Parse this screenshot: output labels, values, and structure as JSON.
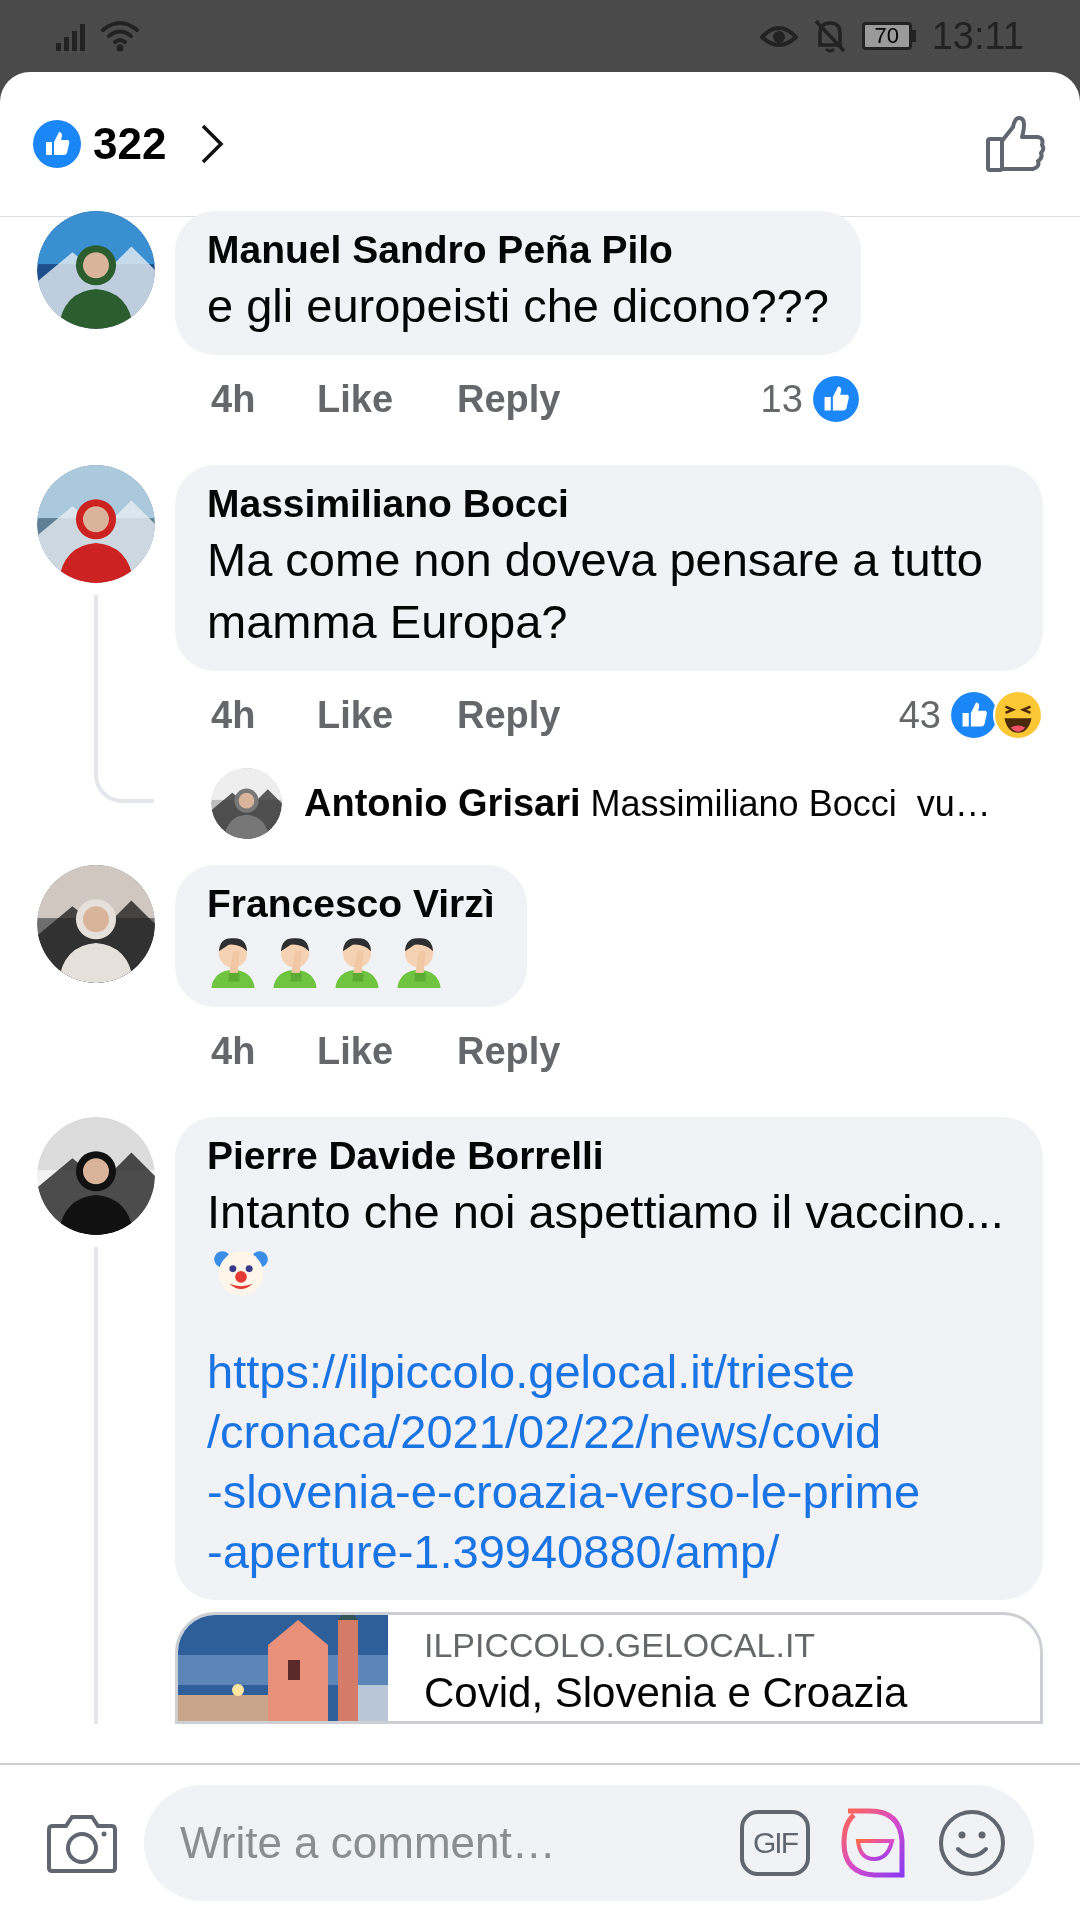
{
  "status_bar": {
    "battery": "70",
    "time": "13:11"
  },
  "header": {
    "reaction_count": "322"
  },
  "comments": [
    {
      "author": "Manuel Sandro Peña Pilo",
      "lines": [
        "e gli europeisti che dicono???"
      ],
      "time": "4h",
      "like": "Like",
      "reply": "Reply",
      "reaction_count": "13",
      "reactions": [
        {
          "kind": "like"
        }
      ],
      "thread": false
    },
    {
      "author": "Massimiliano Bocci",
      "lines": [
        "Ma come non doveva pensare a tutto mamma Europa?"
      ],
      "time": "4h",
      "like": "Like",
      "reply": "Reply",
      "reaction_count": "43",
      "reactions": [
        {
          "kind": "like"
        },
        {
          "kind": "haha"
        }
      ],
      "thread": true,
      "replies": [
        {
          "author": "Antonio Grisari",
          "text": "Massimiliano Bocci  vu…"
        }
      ]
    },
    {
      "author": "Francesco Virzì",
      "emojis": [
        {
          "kind": "facepalm"
        },
        {
          "kind": "facepalm"
        },
        {
          "kind": "facepalm"
        },
        {
          "kind": "facepalm"
        }
      ],
      "time": "4h",
      "like": "Like",
      "reply": "Reply",
      "thread": false
    },
    {
      "author": "Pierre Davide Borrelli",
      "lines": [
        "Intanto che noi aspettiamo il vaccino..."
      ],
      "trailing_emoji": {
        "kind": "clown"
      },
      "link_lines": [
        "https://ilpiccolo.gelocal.it/trieste",
        "/cronaca/2021/02/22/news/covid",
        "-slovenia-e-croazia-verso-le-prime",
        "-aperture-1.39940880/amp/"
      ],
      "thread": true,
      "preview": {
        "kind": "picture",
        "domain": "ILPICCOLO.GELOCAL.IT",
        "title": "Covid, Slovenia e Croazia"
      }
    }
  ],
  "composer": {
    "placeholder": "Write a comment…",
    "gif_label": "GIF"
  }
}
